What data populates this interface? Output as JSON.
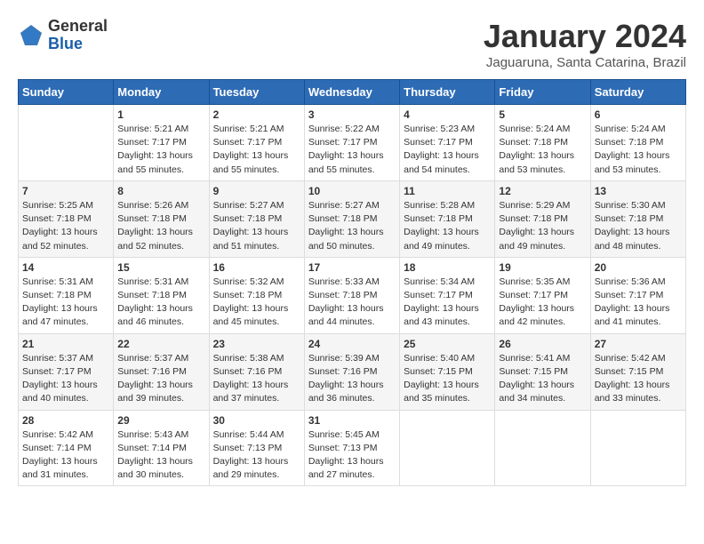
{
  "header": {
    "logo_general": "General",
    "logo_blue": "Blue",
    "month_title": "January 2024",
    "location": "Jaguaruna, Santa Catarina, Brazil"
  },
  "days_of_week": [
    "Sunday",
    "Monday",
    "Tuesday",
    "Wednesday",
    "Thursday",
    "Friday",
    "Saturday"
  ],
  "weeks": [
    [
      {
        "num": "",
        "sunrise": "",
        "sunset": "",
        "daylight": ""
      },
      {
        "num": "1",
        "sunrise": "Sunrise: 5:21 AM",
        "sunset": "Sunset: 7:17 PM",
        "daylight": "Daylight: 13 hours and 55 minutes."
      },
      {
        "num": "2",
        "sunrise": "Sunrise: 5:21 AM",
        "sunset": "Sunset: 7:17 PM",
        "daylight": "Daylight: 13 hours and 55 minutes."
      },
      {
        "num": "3",
        "sunrise": "Sunrise: 5:22 AM",
        "sunset": "Sunset: 7:17 PM",
        "daylight": "Daylight: 13 hours and 55 minutes."
      },
      {
        "num": "4",
        "sunrise": "Sunrise: 5:23 AM",
        "sunset": "Sunset: 7:17 PM",
        "daylight": "Daylight: 13 hours and 54 minutes."
      },
      {
        "num": "5",
        "sunrise": "Sunrise: 5:24 AM",
        "sunset": "Sunset: 7:18 PM",
        "daylight": "Daylight: 13 hours and 53 minutes."
      },
      {
        "num": "6",
        "sunrise": "Sunrise: 5:24 AM",
        "sunset": "Sunset: 7:18 PM",
        "daylight": "Daylight: 13 hours and 53 minutes."
      }
    ],
    [
      {
        "num": "7",
        "sunrise": "Sunrise: 5:25 AM",
        "sunset": "Sunset: 7:18 PM",
        "daylight": "Daylight: 13 hours and 52 minutes."
      },
      {
        "num": "8",
        "sunrise": "Sunrise: 5:26 AM",
        "sunset": "Sunset: 7:18 PM",
        "daylight": "Daylight: 13 hours and 52 minutes."
      },
      {
        "num": "9",
        "sunrise": "Sunrise: 5:27 AM",
        "sunset": "Sunset: 7:18 PM",
        "daylight": "Daylight: 13 hours and 51 minutes."
      },
      {
        "num": "10",
        "sunrise": "Sunrise: 5:27 AM",
        "sunset": "Sunset: 7:18 PM",
        "daylight": "Daylight: 13 hours and 50 minutes."
      },
      {
        "num": "11",
        "sunrise": "Sunrise: 5:28 AM",
        "sunset": "Sunset: 7:18 PM",
        "daylight": "Daylight: 13 hours and 49 minutes."
      },
      {
        "num": "12",
        "sunrise": "Sunrise: 5:29 AM",
        "sunset": "Sunset: 7:18 PM",
        "daylight": "Daylight: 13 hours and 49 minutes."
      },
      {
        "num": "13",
        "sunrise": "Sunrise: 5:30 AM",
        "sunset": "Sunset: 7:18 PM",
        "daylight": "Daylight: 13 hours and 48 minutes."
      }
    ],
    [
      {
        "num": "14",
        "sunrise": "Sunrise: 5:31 AM",
        "sunset": "Sunset: 7:18 PM",
        "daylight": "Daylight: 13 hours and 47 minutes."
      },
      {
        "num": "15",
        "sunrise": "Sunrise: 5:31 AM",
        "sunset": "Sunset: 7:18 PM",
        "daylight": "Daylight: 13 hours and 46 minutes."
      },
      {
        "num": "16",
        "sunrise": "Sunrise: 5:32 AM",
        "sunset": "Sunset: 7:18 PM",
        "daylight": "Daylight: 13 hours and 45 minutes."
      },
      {
        "num": "17",
        "sunrise": "Sunrise: 5:33 AM",
        "sunset": "Sunset: 7:18 PM",
        "daylight": "Daylight: 13 hours and 44 minutes."
      },
      {
        "num": "18",
        "sunrise": "Sunrise: 5:34 AM",
        "sunset": "Sunset: 7:17 PM",
        "daylight": "Daylight: 13 hours and 43 minutes."
      },
      {
        "num": "19",
        "sunrise": "Sunrise: 5:35 AM",
        "sunset": "Sunset: 7:17 PM",
        "daylight": "Daylight: 13 hours and 42 minutes."
      },
      {
        "num": "20",
        "sunrise": "Sunrise: 5:36 AM",
        "sunset": "Sunset: 7:17 PM",
        "daylight": "Daylight: 13 hours and 41 minutes."
      }
    ],
    [
      {
        "num": "21",
        "sunrise": "Sunrise: 5:37 AM",
        "sunset": "Sunset: 7:17 PM",
        "daylight": "Daylight: 13 hours and 40 minutes."
      },
      {
        "num": "22",
        "sunrise": "Sunrise: 5:37 AM",
        "sunset": "Sunset: 7:16 PM",
        "daylight": "Daylight: 13 hours and 39 minutes."
      },
      {
        "num": "23",
        "sunrise": "Sunrise: 5:38 AM",
        "sunset": "Sunset: 7:16 PM",
        "daylight": "Daylight: 13 hours and 37 minutes."
      },
      {
        "num": "24",
        "sunrise": "Sunrise: 5:39 AM",
        "sunset": "Sunset: 7:16 PM",
        "daylight": "Daylight: 13 hours and 36 minutes."
      },
      {
        "num": "25",
        "sunrise": "Sunrise: 5:40 AM",
        "sunset": "Sunset: 7:15 PM",
        "daylight": "Daylight: 13 hours and 35 minutes."
      },
      {
        "num": "26",
        "sunrise": "Sunrise: 5:41 AM",
        "sunset": "Sunset: 7:15 PM",
        "daylight": "Daylight: 13 hours and 34 minutes."
      },
      {
        "num": "27",
        "sunrise": "Sunrise: 5:42 AM",
        "sunset": "Sunset: 7:15 PM",
        "daylight": "Daylight: 13 hours and 33 minutes."
      }
    ],
    [
      {
        "num": "28",
        "sunrise": "Sunrise: 5:42 AM",
        "sunset": "Sunset: 7:14 PM",
        "daylight": "Daylight: 13 hours and 31 minutes."
      },
      {
        "num": "29",
        "sunrise": "Sunrise: 5:43 AM",
        "sunset": "Sunset: 7:14 PM",
        "daylight": "Daylight: 13 hours and 30 minutes."
      },
      {
        "num": "30",
        "sunrise": "Sunrise: 5:44 AM",
        "sunset": "Sunset: 7:13 PM",
        "daylight": "Daylight: 13 hours and 29 minutes."
      },
      {
        "num": "31",
        "sunrise": "Sunrise: 5:45 AM",
        "sunset": "Sunset: 7:13 PM",
        "daylight": "Daylight: 13 hours and 27 minutes."
      },
      {
        "num": "",
        "sunrise": "",
        "sunset": "",
        "daylight": ""
      },
      {
        "num": "",
        "sunrise": "",
        "sunset": "",
        "daylight": ""
      },
      {
        "num": "",
        "sunrise": "",
        "sunset": "",
        "daylight": ""
      }
    ]
  ]
}
